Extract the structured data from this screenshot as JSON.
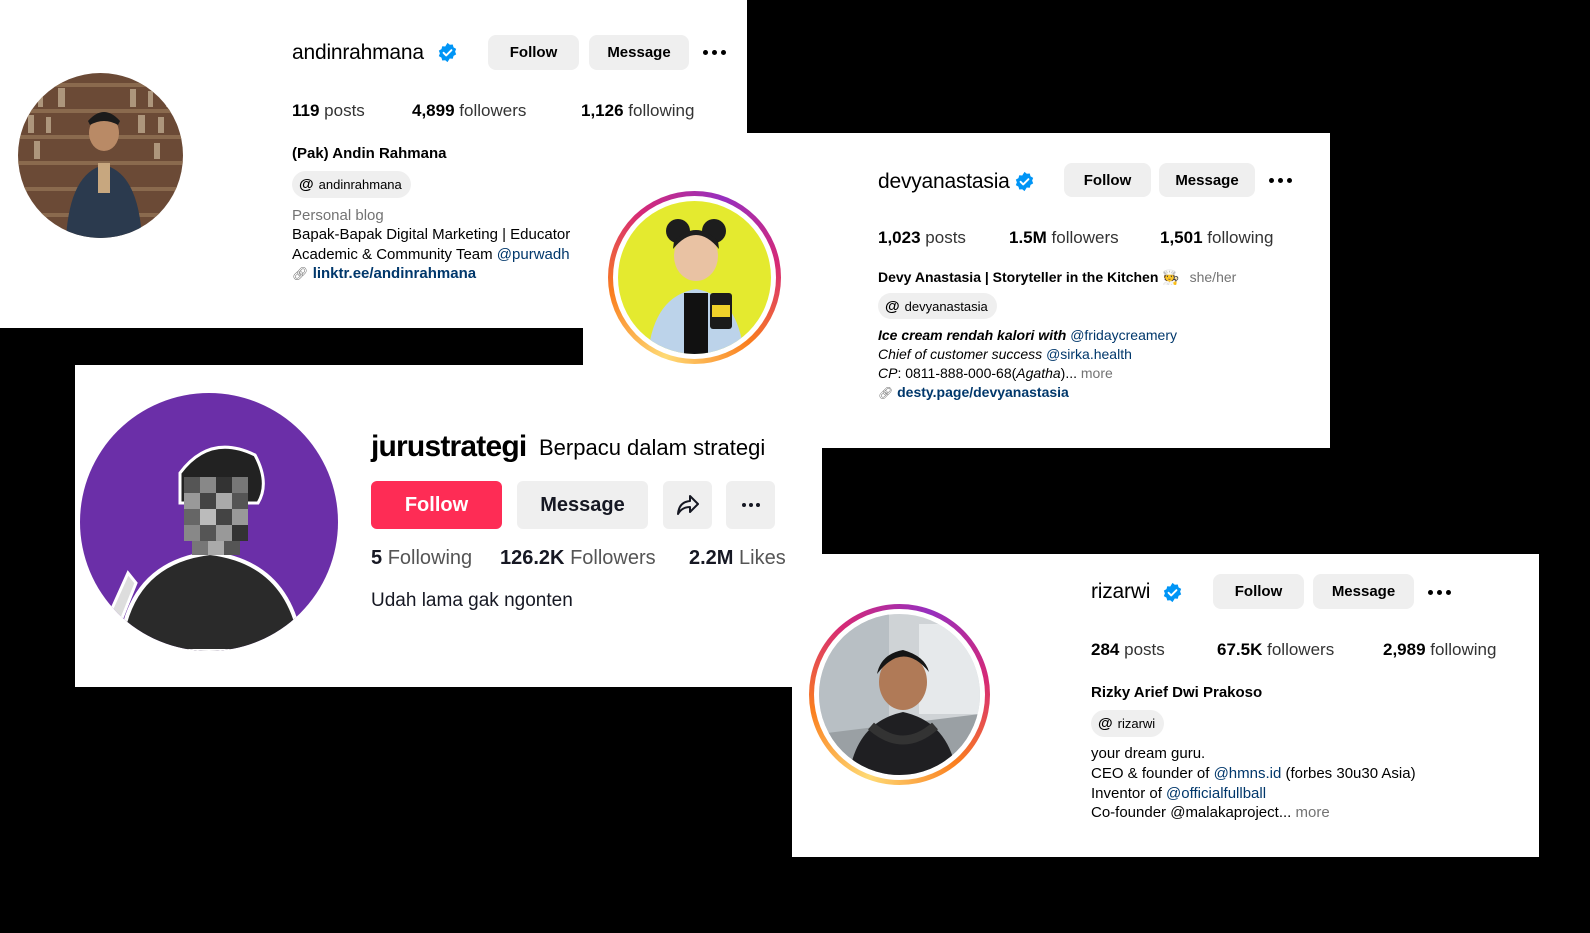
{
  "andin": {
    "username": "andinrahmana",
    "follow": "Follow",
    "message": "Message",
    "posts_num": "119",
    "posts_label": "posts",
    "followers_num": "4,899",
    "followers_label": "followers",
    "following_num": "1,126",
    "following_label": "following",
    "name": "(Pak) Andin Rahmana",
    "threads": "andinrahmana",
    "category": "Personal blog",
    "bio1": "Bapak-Bapak Digital Marketing | Educator",
    "bio2_text": "Academic & Community Team ",
    "bio2_mention": "@purwadh",
    "link": "linktr.ee/andinrahmana"
  },
  "devy": {
    "username": "devyanastasia",
    "follow": "Follow",
    "message": "Message",
    "posts_num": "1,023",
    "posts_label": "posts",
    "followers_num": "1.5M",
    "followers_label": "followers",
    "following_num": "1,501",
    "following_label": "following",
    "name": "Devy Anastasia | Storyteller in the Kitchen",
    "emoji": "🧑‍🍳",
    "pronouns": "she/her",
    "threads": "devyanastasia",
    "bio1_text": "Ice cream rendah kalori with ",
    "bio1_mention": "@fridaycreamery",
    "bio2_text": "Chief of customer success ",
    "bio2_mention": "@sirka.health",
    "bio3_a": "CP",
    "bio3_b": ": 0811-888-000-68(",
    "bio3_c": "Agatha",
    "bio3_d": ")... ",
    "more": "more",
    "link": "desty.page/devyanastasia"
  },
  "juru": {
    "username": "jurustrategi",
    "nickname": "Berpacu dalam strategi",
    "follow": "Follow",
    "message": "Message",
    "following_num": "5",
    "following_label": "Following",
    "followers_num": "126.2K",
    "followers_label": "Followers",
    "likes_num": "2.2M",
    "likes_label": "Likes",
    "bio": "Udah lama gak ngonten",
    "accent": "#fe2c55",
    "avatar_bg": "#6b2fa8"
  },
  "riza": {
    "username": "rizarwi",
    "follow": "Follow",
    "message": "Message",
    "posts_num": "284",
    "posts_label": "posts",
    "followers_num": "67.5K",
    "followers_label": "followers",
    "following_num": "2,989",
    "following_label": "following",
    "name": "Rizky Arief Dwi Prakoso",
    "threads": "rizarwi",
    "bio1": "your dream guru.",
    "bio2_text": "CEO & founder of ",
    "bio2_mention": "@hmns.id",
    "bio2_tail": " (forbes 30u30 Asia)",
    "bio3_text": "Inventor of ",
    "bio3_mention": "@officialfullball",
    "bio4_text": "Co-founder @malakaproject... ",
    "more": "more"
  },
  "colors": {
    "verified": "#0095f6",
    "ig_button": "#efefef",
    "link": "#00376b"
  }
}
